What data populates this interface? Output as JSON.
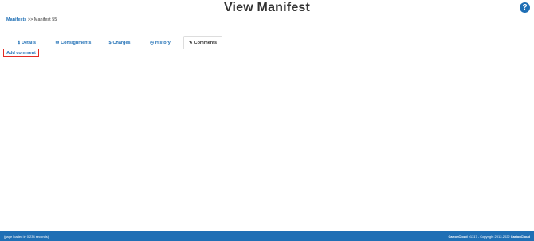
{
  "header": {
    "title": "View Manifest",
    "help_icon": "?"
  },
  "breadcrumb": {
    "link": "Manifests",
    "separator": ">>",
    "current": "Manifest 55"
  },
  "tabs": [
    {
      "label": "Details",
      "icon": "ℹ"
    },
    {
      "label": "Consignments",
      "icon": "✉"
    },
    {
      "label": "Charges",
      "icon": "$"
    },
    {
      "label": "History",
      "icon": "◷"
    },
    {
      "label": "Comments",
      "icon": "✎"
    }
  ],
  "comments": {
    "add_comment_label": "Add comment"
  },
  "footer": {
    "load_time": "(page loaded in 0.234 seconds)",
    "brand": "CartonCloud",
    "version_text": "v1317 - Copyright 2012-2022",
    "owner": "CartonCloud"
  },
  "colors": {
    "accent": "#1f6fb5",
    "highlight": "#e32a22",
    "footer_bg": "#1f6fb5"
  }
}
